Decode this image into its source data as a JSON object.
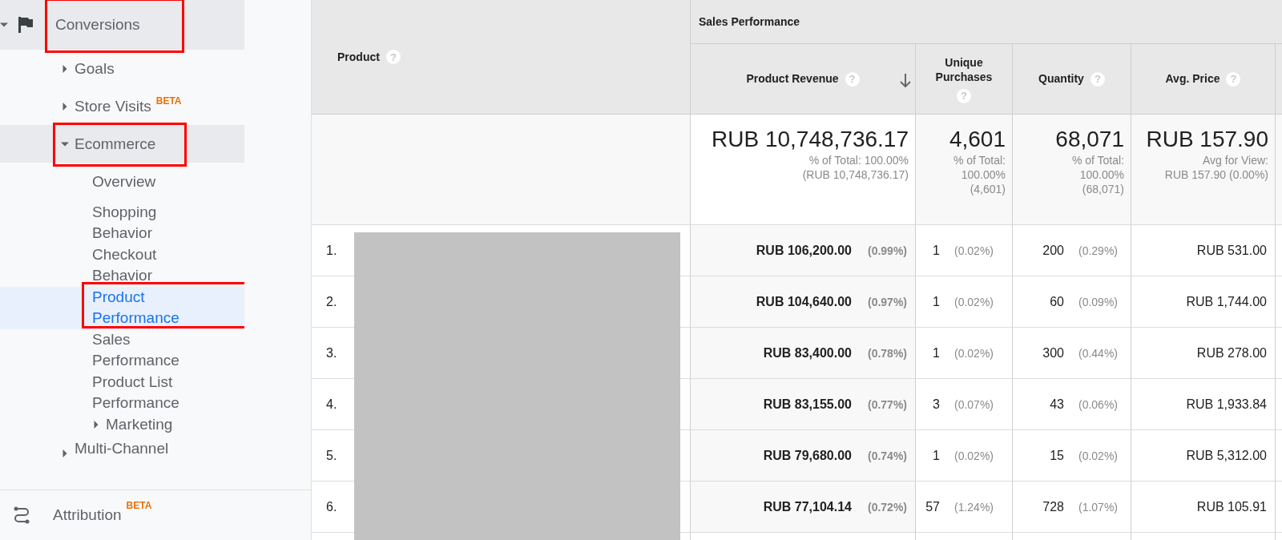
{
  "sidebar": {
    "items": [
      {
        "label": "Conversions",
        "expanded": true,
        "selected": false,
        "highlighted": true,
        "children": [
          {
            "label": "Goals",
            "expanded": false,
            "selected": false,
            "highlighted": false
          },
          {
            "label": "Store Visits",
            "badge": "BETA",
            "expanded": false,
            "selected": false,
            "highlighted": false
          },
          {
            "label": "Ecommerce",
            "expanded": true,
            "selected": false,
            "highlighted": true,
            "children": [
              {
                "label": "Overview",
                "selected": false,
                "highlighted": false
              },
              {
                "label": "Shopping Behavior",
                "selected": false,
                "highlighted": false
              },
              {
                "label": "Checkout Behavior",
                "selected": false,
                "highlighted": false
              },
              {
                "label": "Product Performance",
                "selected": true,
                "highlighted": true
              },
              {
                "label": "Sales Performance",
                "selected": false,
                "highlighted": false
              },
              {
                "label": "Product List Performance",
                "selected": false,
                "highlighted": false
              },
              {
                "label": "Marketing",
                "expanded": false,
                "selected": false,
                "highlighted": false
              }
            ]
          },
          {
            "label": "Multi-Channel",
            "expanded": false,
            "selected": false,
            "highlighted": false
          }
        ]
      }
    ],
    "footer": {
      "label": "Attribution",
      "badge": "BETA"
    }
  },
  "table": {
    "group_header": "Sales Performance",
    "product_redacted": true,
    "columns": [
      {
        "label": "Product",
        "help": "?"
      },
      {
        "label": "Product Revenue",
        "help": "?",
        "sorted": true
      },
      {
        "label": "Unique Purchases",
        "help": "?"
      },
      {
        "label": "Quantity",
        "help": "?"
      },
      {
        "label": "Avg. Price",
        "help": "?"
      }
    ],
    "totals": [
      {
        "value": "RUB 10,748,736.17",
        "note": [
          "% of Total: 100.00%",
          "(RUB 10,748,736.17)"
        ]
      },
      {
        "value": "4,601",
        "note": [
          "% of Total:",
          "100.00%",
          "(4,601)"
        ]
      },
      {
        "value": "68,071",
        "note": [
          "% of Total:",
          "100.00%",
          "(68,071)"
        ]
      },
      {
        "value": "RUB 157.90",
        "note": [
          "Avg for View:",
          "RUB 157.90 (0.00%)"
        ]
      }
    ],
    "rows": [
      {
        "index": "1.",
        "revenue": "RUB 106,200.00",
        "revenue_pct": "(0.99%)",
        "unique": "1",
        "unique_pct": "(0.02%)",
        "quantity": "200",
        "quantity_pct": "(0.29%)",
        "avg_price": "RUB 531.00"
      },
      {
        "index": "2.",
        "revenue": "RUB 104,640.00",
        "revenue_pct": "(0.97%)",
        "unique": "1",
        "unique_pct": "(0.02%)",
        "quantity": "60",
        "quantity_pct": "(0.09%)",
        "avg_price": "RUB 1,744.00"
      },
      {
        "index": "3.",
        "revenue": "RUB 83,400.00",
        "revenue_pct": "(0.78%)",
        "unique": "1",
        "unique_pct": "(0.02%)",
        "quantity": "300",
        "quantity_pct": "(0.44%)",
        "avg_price": "RUB 278.00"
      },
      {
        "index": "4.",
        "revenue": "RUB 83,155.00",
        "revenue_pct": "(0.77%)",
        "unique": "3",
        "unique_pct": "(0.07%)",
        "quantity": "43",
        "quantity_pct": "(0.06%)",
        "avg_price": "RUB 1,933.84"
      },
      {
        "index": "5.",
        "revenue": "RUB 79,680.00",
        "revenue_pct": "(0.74%)",
        "unique": "1",
        "unique_pct": "(0.02%)",
        "quantity": "15",
        "quantity_pct": "(0.02%)",
        "avg_price": "RUB 5,312.00"
      },
      {
        "index": "6.",
        "revenue": "RUB 77,104.14",
        "revenue_pct": "(0.72%)",
        "unique": "57",
        "unique_pct": "(1.24%)",
        "quantity": "728",
        "quantity_pct": "(1.07%)",
        "avg_price": "RUB 105.91"
      }
    ]
  }
}
